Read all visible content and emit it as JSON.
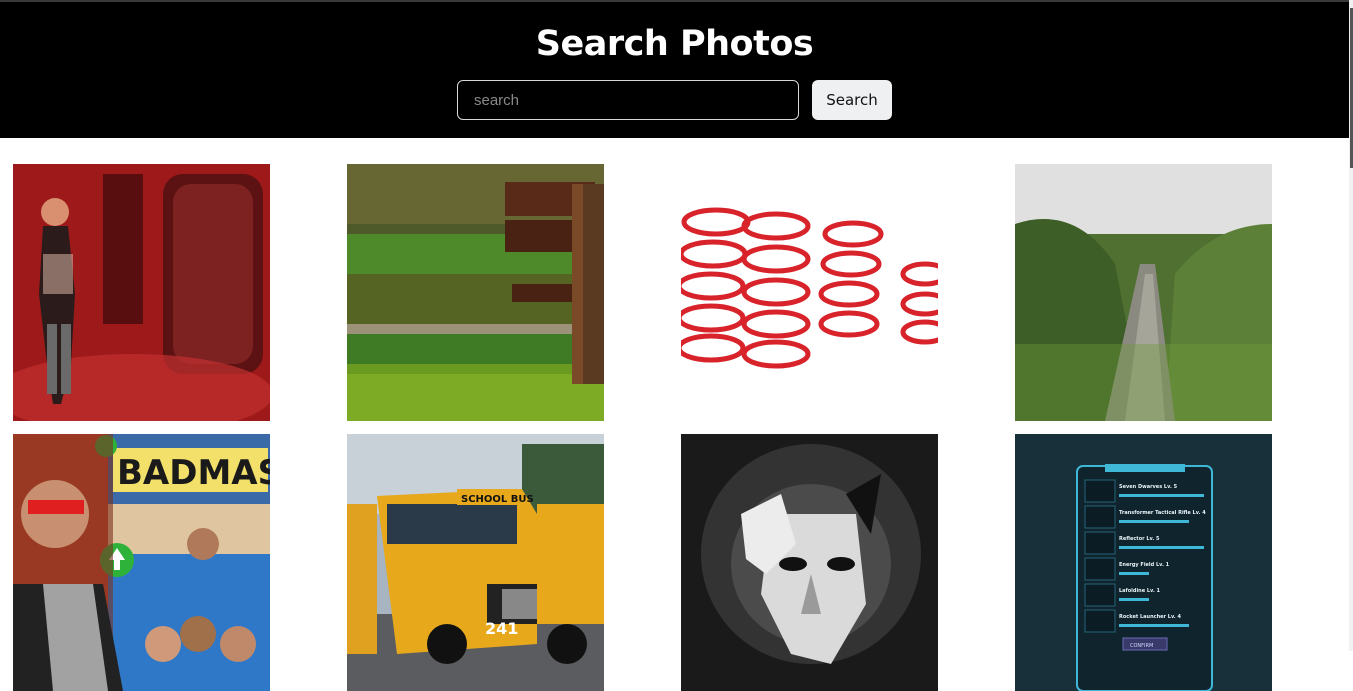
{
  "header": {
    "title": "Search Photos",
    "search_placeholder": "search",
    "search_value": "",
    "search_button_label": "Search",
    "background": "#000000"
  },
  "photos": [
    {
      "subject": "woman in red-lit glass display"
    },
    {
      "subject": "wooden bench over green field"
    },
    {
      "subject": "red coil springs"
    },
    {
      "subject": "water ditch through grass"
    },
    {
      "subject": "thumbnail with man and group",
      "text": "BADMASHI"
    },
    {
      "subject": "yellow school buses",
      "text": "SCHOOL BUS",
      "number": "241"
    },
    {
      "subject": "black and white face art"
    },
    {
      "subject": "game upgrade menu screen",
      "items": [
        "Seven Dwarves Lv. 5",
        "Transformer Tactical Rifle Lv. 4",
        "Reflector Lv. 5",
        "Energy Field Lv. 1",
        "Lafoldine Lv. 1",
        "Rocket Launcher Lv. 4"
      ],
      "button": "CONFIRM"
    }
  ]
}
